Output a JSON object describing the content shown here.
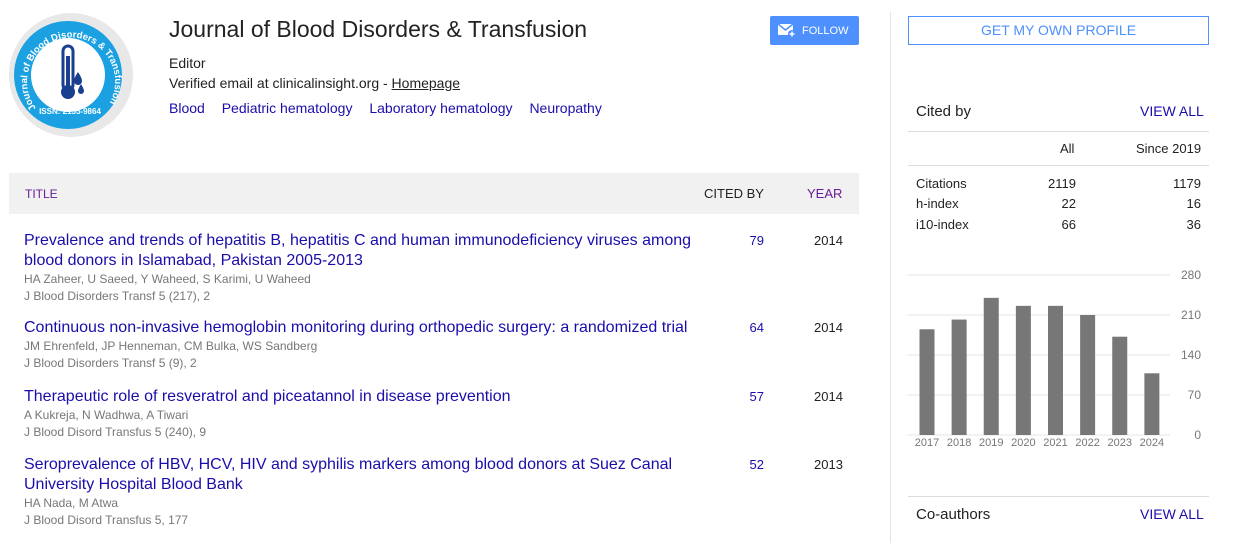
{
  "profile": {
    "name": "Journal of Blood Disorders & Transfusion",
    "affiliation": "Editor",
    "email_text": "Verified email at clinicalinsight.org - ",
    "homepage_label": "Homepage",
    "interests": [
      "Blood",
      "Pediatric hematology",
      "Laboratory hematology",
      "Neuropathy"
    ],
    "logo": {
      "text_arc": "Journal of Blood Disorders & Transfusion",
      "issn": "ISSN: 2155-9864",
      "icon": "thermometer-blood-drop-icon",
      "ring_color": "#1ba1e2"
    }
  },
  "actions": {
    "follow_label": "FOLLOW",
    "get_profile_label": "GET MY OWN PROFILE"
  },
  "table": {
    "col_title": "TITLE",
    "col_cited_by": "CITED BY",
    "col_year": "YEAR",
    "rows": [
      {
        "title": "Prevalence and trends of hepatitis B, hepatitis C and human immunodeficiency viruses among blood donors in Islamabad, Pakistan 2005-2013",
        "authors": "HA Zaheer, U Saeed, Y Waheed, S Karimi, U Waheed",
        "venue": "J Blood Disorders Transf 5 (217), 2",
        "cited_by": "79",
        "year": "2014"
      },
      {
        "title": "Continuous non-invasive hemoglobin monitoring during orthopedic surgery: a randomized trial",
        "authors": "JM Ehrenfeld, JP Henneman, CM Bulka, WS Sandberg",
        "venue": "J Blood Disorders Transf 5 (9), 2",
        "cited_by": "64",
        "year": "2014"
      },
      {
        "title": "Therapeutic role of resveratrol and piceatannol in disease prevention",
        "authors": "A Kukreja, N Wadhwa, A Tiwari",
        "venue": "J Blood Disord Transfus 5 (240), 9",
        "cited_by": "57",
        "year": "2014"
      },
      {
        "title": "Seroprevalence of HBV, HCV, HIV and syphilis markers among blood donors at Suez Canal University Hospital Blood Bank",
        "authors": "HA Nada, M Atwa",
        "venue": "J Blood Disord Transfus 5, 177",
        "cited_by": "52",
        "year": "2013"
      }
    ]
  },
  "cited_by": {
    "title": "Cited by",
    "view_all": "VIEW ALL",
    "col_all": "All",
    "col_since": "Since 2019",
    "stats": [
      {
        "label": "Citations",
        "all": "2119",
        "since": "1179"
      },
      {
        "label": "h-index",
        "all": "22",
        "since": "16"
      },
      {
        "label": "i10-index",
        "all": "66",
        "since": "36"
      }
    ]
  },
  "chart_data": {
    "type": "bar",
    "categories": [
      "2017",
      "2018",
      "2019",
      "2020",
      "2021",
      "2022",
      "2023",
      "2024"
    ],
    "values": [
      185,
      202,
      240,
      226,
      226,
      210,
      172,
      108
    ],
    "yticks": [
      0,
      70,
      140,
      210,
      280
    ],
    "ylim": [
      0,
      280
    ],
    "bar_color": "#777777",
    "grid": true
  },
  "coauthors": {
    "title": "Co-authors",
    "view_all": "VIEW ALL"
  }
}
